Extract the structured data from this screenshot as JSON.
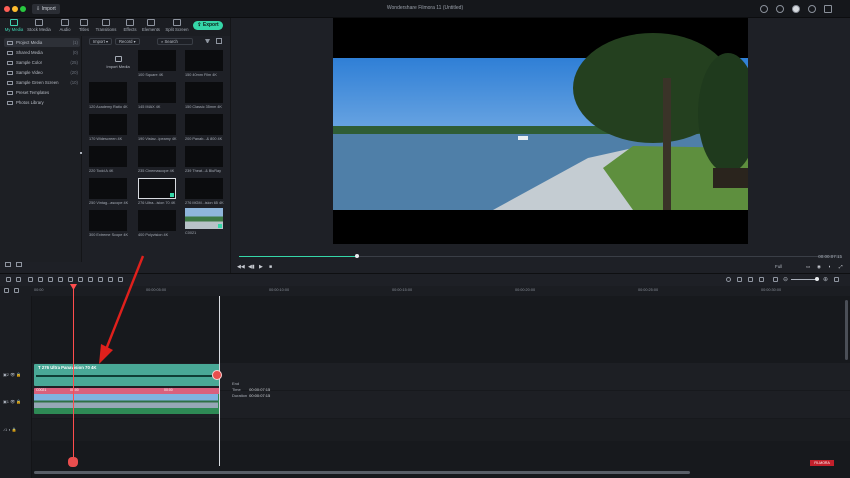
{
  "window": {
    "title": "Wondershare Filmora 11 (Untitled)",
    "import_label": "Import"
  },
  "tabs": [
    {
      "label": "My Media",
      "active": true
    },
    {
      "label": "Stock Media"
    },
    {
      "label": "Audio"
    },
    {
      "label": "Titles"
    },
    {
      "label": "Transitions"
    },
    {
      "label": "Effects"
    },
    {
      "label": "Elements"
    },
    {
      "label": "Split Screen"
    }
  ],
  "export_label": "Export",
  "sidebar": {
    "items": [
      {
        "label": "Project Media",
        "count": "(1)",
        "selected": true
      },
      {
        "label": "Shared Media",
        "count": "(0)"
      },
      {
        "label": "Sample Color",
        "count": "(25)"
      },
      {
        "label": "Sample Video",
        "count": "(20)"
      },
      {
        "label": "Sample Green Screen",
        "count": "(10)"
      },
      {
        "label": "Preset Templates",
        "count": ""
      },
      {
        "label": "Photos Library",
        "count": ""
      }
    ]
  },
  "media_toolbar": {
    "import_label": "Import",
    "record_label": "Record",
    "search_label": "Search"
  },
  "media": {
    "import_label": "Import Media",
    "items": [
      "100 Square 4K",
      "150 40mm Film 4K",
      "120 Academy Ratio 4K",
      "145 IMAX 4K",
      "150 Classic 35mm 4K",
      "170 Widescreen 4K",
      "190 Vistav...ipeamy 4K",
      "200 Panab...& 800 4K",
      "220 Todd A 4K",
      "235 Cinemascope 4K",
      "239 Theat...& BluRay",
      "250 Vintag...ascope 4K",
      "276 Ultra...ision 70 4K",
      "276 MGM...ision 65 4K",
      "300 Extreme Scope 4K",
      "400 Polyvision 4K",
      "C0021"
    ]
  },
  "preview": {
    "timecode": "00:00:07:15",
    "quality": "Full"
  },
  "timeline": {
    "ruler": [
      "00:00",
      "00:00:05:00",
      "00:00:10:00",
      "00:00:15:00",
      "00:00:20:00",
      "00:00:25:00",
      "00:00:30:00"
    ],
    "title_clip": "276 Ultra Panavision 70 4K",
    "video_clip_label": "C0021",
    "audio_marker": "00:00",
    "info": {
      "end_time_label": "End Time",
      "end_time_value": "00:00:07:15",
      "duration_label": "Duration",
      "duration_value": "00:00:07:15"
    },
    "watermark": "FILMORA"
  },
  "colors": {
    "accent": "#35d6a8",
    "title_clip": "#49a896",
    "video_clip": "#2e8a55",
    "playhead": "#ff4d4d"
  }
}
